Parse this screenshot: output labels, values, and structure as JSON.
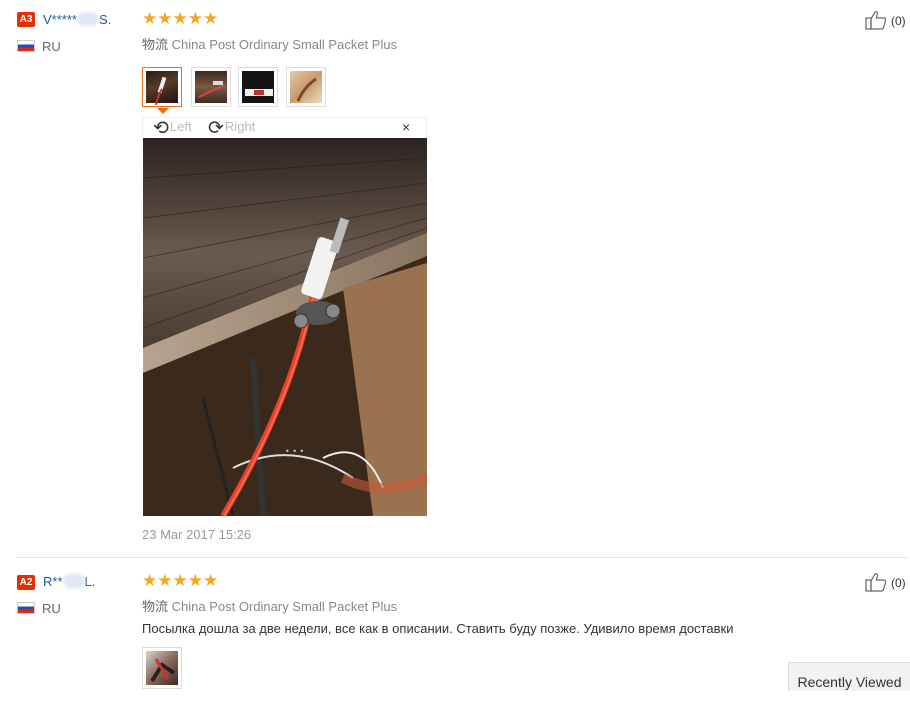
{
  "reviews": [
    {
      "badge": "A3",
      "name_start": "V*****",
      "name_end": "S.",
      "country": "RU",
      "rating_stars": "★★★★★",
      "rating": 5,
      "shipping_label": "物流",
      "shipping": "China Post Ordinary Small Packet Plus",
      "helpful": "(0)",
      "photo_viewer": {
        "rotate_left": "Left",
        "rotate_right": "Right",
        "close": "×",
        "dots": "• • •"
      },
      "date": "23 Mar 2017 15:26"
    },
    {
      "badge": "A2",
      "name_start": "R**",
      "name_end": "L.",
      "country": "RU",
      "rating_stars": "★★★★★",
      "rating": 5,
      "shipping_label": "物流",
      "shipping": "China Post Ordinary Small Packet Plus",
      "helpful": "(0)",
      "comment": "Посылка дошла за две недели, все как в описании. Ставить буду позже. Удивило время доставки"
    }
  ],
  "recently_viewed": "Recently Viewed",
  "icons": {
    "flag": "russia-flag-icon",
    "helpful": "thumbs-up-icon",
    "rotate_left": "rotate-left-icon",
    "rotate_right": "rotate-right-icon",
    "close": "close-icon"
  },
  "colors": {
    "accent": "#e96d1a",
    "badge": "#e62e04",
    "stars": "#f5a623",
    "name_link": "#1a5aa6"
  }
}
